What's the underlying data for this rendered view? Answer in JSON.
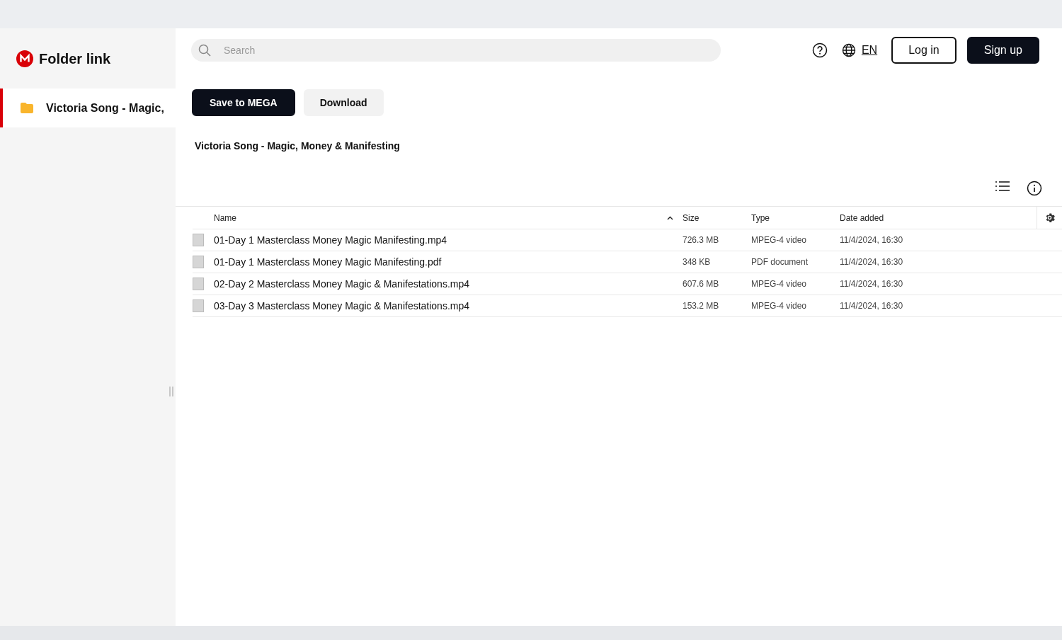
{
  "app": {
    "title": "Folder link"
  },
  "search": {
    "placeholder": "Search"
  },
  "language": "EN",
  "auth_buttons": [
    {
      "label": "Log in",
      "kind": "outline"
    },
    {
      "label": "Sign up",
      "kind": "solid"
    }
  ],
  "sidebar": {
    "items": [
      {
        "label": "Victoria Song - Magic,",
        "selected": true
      }
    ]
  },
  "actions": [
    {
      "label": "Save to MEGA",
      "kind": "solid"
    },
    {
      "label": "Download",
      "kind": "light"
    }
  ],
  "breadcrumb": "Victoria Song - Magic, Money & Manifesting",
  "table": {
    "columns": [
      {
        "label": "Name",
        "sorted": true
      },
      {
        "label": "Size",
        "sorted": false
      },
      {
        "label": "Type",
        "sorted": false
      },
      {
        "label": "Date added",
        "sorted": false
      }
    ],
    "rows": [
      {
        "name": "01-Day 1 Masterclass Money Magic Manifesting.mp4",
        "size": "726.3 MB",
        "type": "MPEG-4 video",
        "date": "11/4/2024, 16:30"
      },
      {
        "name": "01-Day 1 Masterclass Money Magic Manifesting.pdf",
        "size": "348 KB",
        "type": "PDF document",
        "date": "11/4/2024, 16:30"
      },
      {
        "name": "02-Day 2 Masterclass Money Magic & Manifestations.mp4",
        "size": "607.6 MB",
        "type": "MPEG-4 video",
        "date": "11/4/2024, 16:30"
      },
      {
        "name": "03-Day 3 Masterclass Money Magic & Manifestations.mp4",
        "size": "153.2 MB",
        "type": "MPEG-4 video",
        "date": "11/4/2024, 16:30"
      }
    ]
  }
}
